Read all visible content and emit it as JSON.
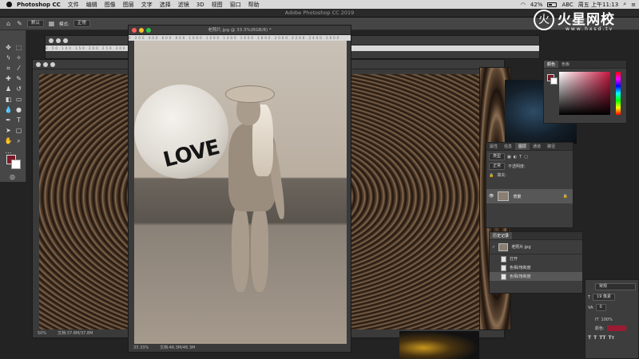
{
  "menubar": {
    "app_name": "Photoshop CC",
    "items": [
      "文件",
      "编辑",
      "图像",
      "图层",
      "文字",
      "选择",
      "滤镜",
      "3D",
      "视图",
      "窗口",
      "帮助"
    ],
    "battery": "42%",
    "input": "ABC",
    "clock": "周五 上午11:13"
  },
  "window": {
    "title": "Adobe Photoshop CC 2019"
  },
  "options_bar": {
    "mode_label": "模式:",
    "mode_value": "正常",
    "preset_value": "默认"
  },
  "documents": {
    "left": {
      "zoom": "50%",
      "status": "文档:37.8M/37.8M"
    },
    "center": {
      "title": "老照片.jpg @ 33.3%(RGB/8) *",
      "zoom": "33.33%",
      "status": "文档:46.3M/46.3M",
      "ball_text": "LOVE"
    }
  },
  "panels": {
    "color": {
      "tabs": [
        "颜色",
        "色板"
      ]
    },
    "layers": {
      "tabs": [
        "属性",
        "信息",
        "图层",
        "通道",
        "路径"
      ],
      "kind_value": "类型",
      "blend_value": "正常",
      "opacity_label": "不透明度:",
      "fill_label": "填充:",
      "layer_name": "背景"
    },
    "history": {
      "title": "历史记录",
      "snapshot": "老照片.jpg",
      "items": [
        "打开",
        "色相/饱和度",
        "色相/饱和度"
      ]
    },
    "character": {
      "style_value": "常规",
      "size_value": "19 像素",
      "tracking_value": "0",
      "scale_value": "100%",
      "color_label": "颜色:"
    }
  },
  "watermark": {
    "logo_char": "火",
    "name": "火星网校",
    "url": "www.hxsd.tv"
  },
  "colors": {
    "foreground": "#7b1a28",
    "accent_red": "#c7163f"
  }
}
